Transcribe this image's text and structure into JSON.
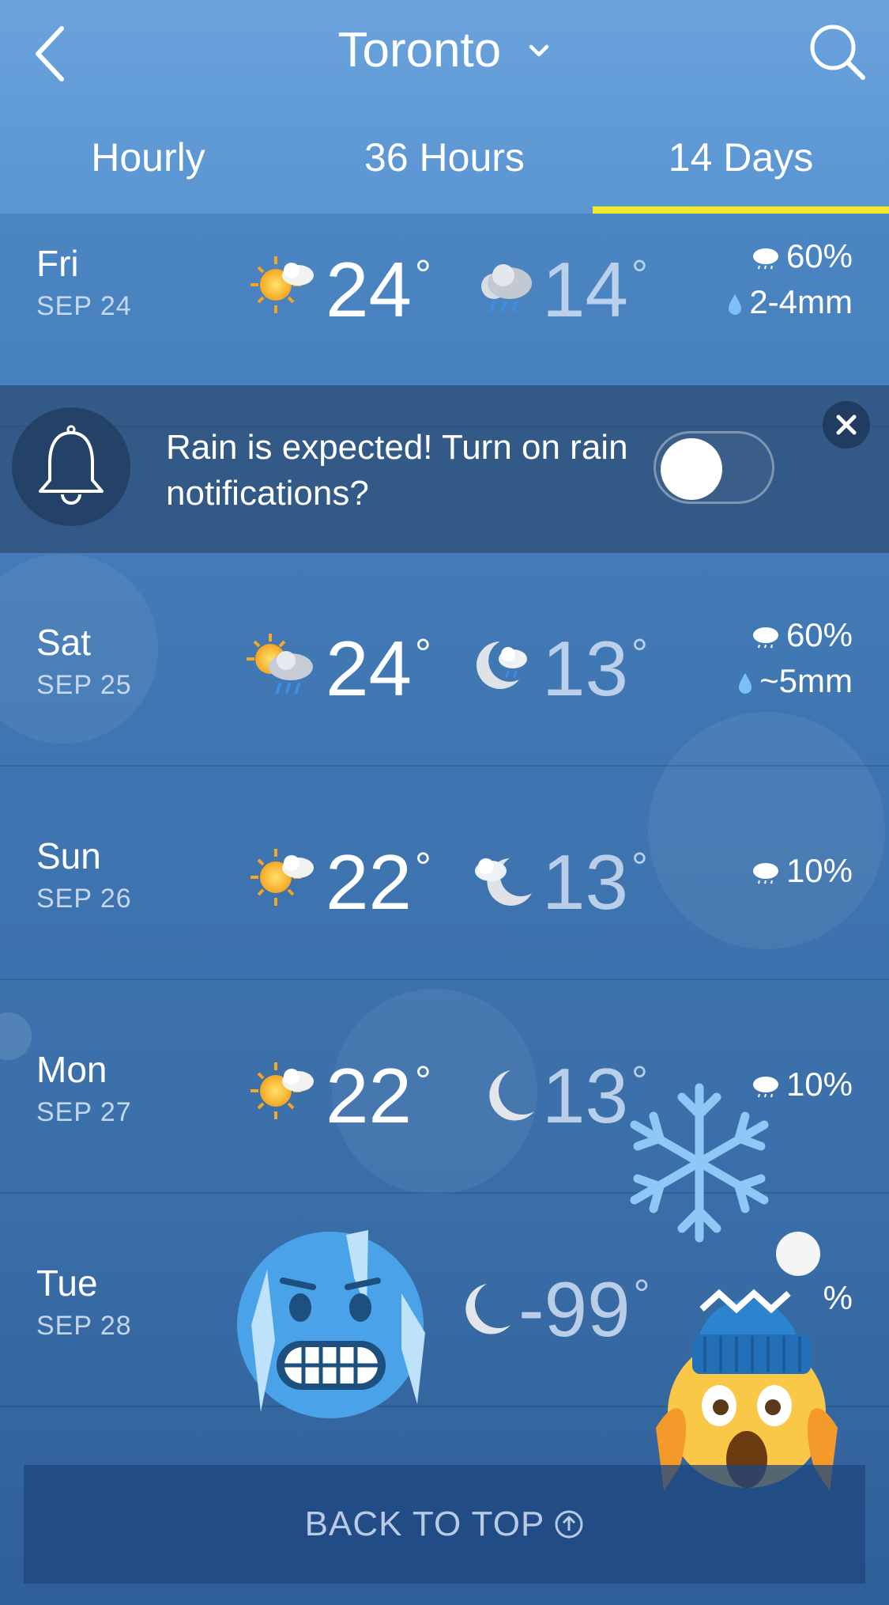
{
  "header": {
    "city": "Toronto",
    "back_icon": "chevron-left-icon",
    "search_icon": "search-icon"
  },
  "tabs": [
    {
      "label": "Hourly",
      "active": false
    },
    {
      "label": "36 Hours",
      "active": false
    },
    {
      "label": "14 Days",
      "active": true
    }
  ],
  "colors": {
    "tab_indicator": "#f1e92a",
    "background_top": "#6aa3dc",
    "background_bottom": "#2f5f98"
  },
  "days": [
    {
      "day": "Fri",
      "date": "SEP 24",
      "high": "24",
      "low": "14",
      "day_icon": "sun-cloud-icon",
      "night_icon": "cloud-rain-icon",
      "precip_chance": "60%",
      "precip_amount": "2-4mm"
    },
    {
      "day": "Sat",
      "date": "SEP 25",
      "high": "24",
      "low": "13",
      "day_icon": "sun-cloud-rain-icon",
      "night_icon": "moon-cloud-rain-icon",
      "precip_chance": "60%",
      "precip_amount": "~5mm"
    },
    {
      "day": "Sun",
      "date": "SEP 26",
      "high": "22",
      "low": "13",
      "day_icon": "sun-cloud-icon",
      "night_icon": "moon-cloud-icon",
      "precip_chance": "10%"
    },
    {
      "day": "Mon",
      "date": "SEP 27",
      "high": "22",
      "low": "13",
      "day_icon": "sun-cloud-icon",
      "night_icon": "moon-icon",
      "precip_chance": "10%"
    },
    {
      "day": "Tue",
      "date": "SEP 28",
      "low": "-99",
      "night_icon": "moon-icon",
      "precip_chance": "%"
    }
  ],
  "banner": {
    "text": "Rain is expected! Turn on rain notifications?",
    "toggle_on": false,
    "icon": "bell-icon",
    "close_icon": "close-icon"
  },
  "footer": {
    "back_to_top": "BACK TO TOP",
    "icon": "arrow-up-circle-icon"
  },
  "stickers": [
    "snowflake-icon",
    "cold-face-emoji",
    "screaming-face-with-hat-emoji"
  ]
}
